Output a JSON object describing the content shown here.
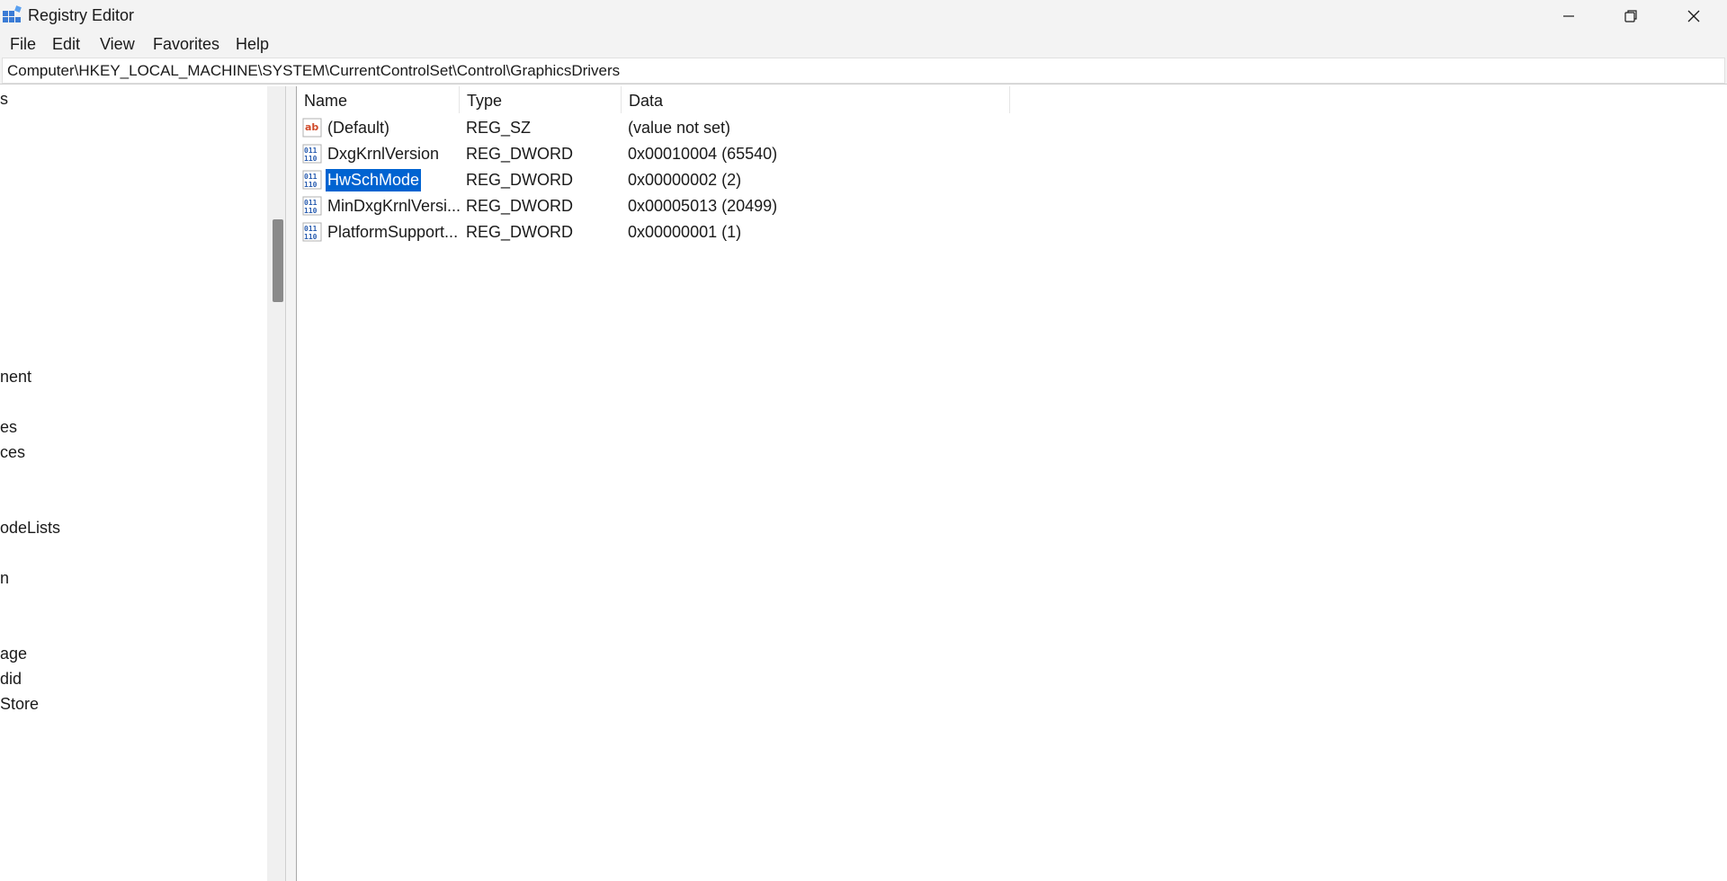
{
  "window": {
    "title": "Registry Editor",
    "icon": "registry-editor-icon"
  },
  "menu": {
    "items": [
      "File",
      "Edit",
      "View",
      "Favorites",
      "Help"
    ]
  },
  "address": {
    "path": "Computer\\HKEY_LOCAL_MACHINE\\SYSTEM\\CurrentControlSet\\Control\\GraphicsDrivers"
  },
  "tree": {
    "items": [
      "s",
      "nent",
      "es",
      "ces",
      "odeLists",
      "n",
      "age",
      "did",
      "Store"
    ]
  },
  "list": {
    "columns": [
      "Name",
      "Type",
      "Data"
    ],
    "rows": [
      {
        "name": "(Default)",
        "type": "REG_SZ",
        "data": "(value not set)",
        "icon": "string-value-icon"
      },
      {
        "name": "DxgKrnlVersion",
        "type": "REG_DWORD",
        "data": "0x00010004 (65540)",
        "icon": "binary-value-icon"
      },
      {
        "name": "HwSchMode",
        "type": "REG_DWORD",
        "data": "0x00000002 (2)",
        "icon": "binary-value-icon",
        "selected": true
      },
      {
        "name": "MinDxgKrnlVersi...",
        "type": "REG_DWORD",
        "data": "0x00005013 (20499)",
        "icon": "binary-value-icon"
      },
      {
        "name": "PlatformSupport...",
        "type": "REG_DWORD",
        "data": "0x00000001 (1)",
        "icon": "binary-value-icon"
      }
    ]
  },
  "colors": {
    "selection": "#0063d1",
    "string_icon": "#d04a2a",
    "binary_icon": "#2a5db0"
  }
}
